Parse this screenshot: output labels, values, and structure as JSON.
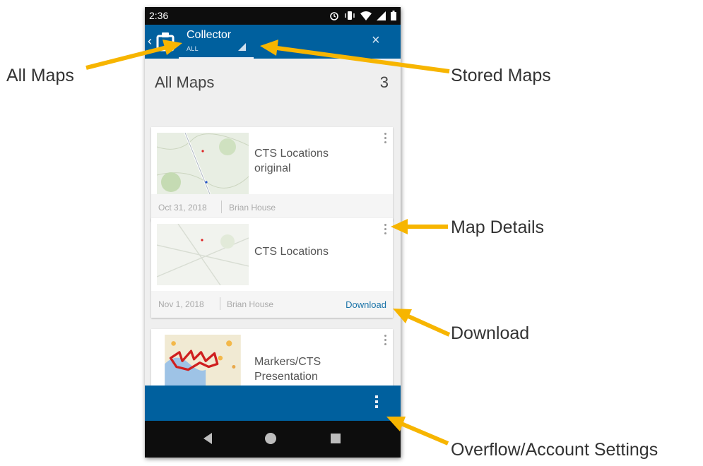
{
  "status_bar": {
    "time": "2:36",
    "icons": [
      "alarm-icon",
      "vibrate-icon",
      "wifi-icon",
      "signal-icon",
      "battery-icon"
    ]
  },
  "app_bar": {
    "title": "Collector",
    "subtitle": "ALL",
    "close_glyph": "×",
    "back_glyph": "‹"
  },
  "list": {
    "heading": "All Maps",
    "count": "3",
    "cards": [
      {
        "title_line1": "CTS Locations",
        "title_line2": "original",
        "date": "Oct 31, 2018",
        "owner": "Brian House",
        "action": ""
      },
      {
        "title_line1": "CTS Locations",
        "title_line2": "",
        "date": "Nov 1, 2018",
        "owner": "Brian House",
        "action": "Download"
      },
      {
        "title_line1": "Markers/CTS",
        "title_line2": "Presentation",
        "date": "",
        "owner": "",
        "action": ""
      }
    ]
  },
  "annotations": {
    "all_maps": "All Maps",
    "stored_maps": "Stored Maps",
    "map_details": "Map Details",
    "download": "Download",
    "overflow": "Overflow/Account Settings"
  },
  "colors": {
    "accent_blue": "#00609e",
    "annotation_arrow": "#f7b500",
    "link_blue": "#1a73a8"
  }
}
